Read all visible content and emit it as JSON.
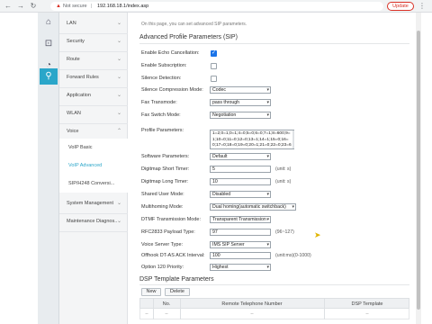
{
  "browser": {
    "security_label": "Not secure",
    "separator": "|",
    "url": "192.168.18.1/index.asp",
    "update_label": "Update",
    "menu_icon": "⋮"
  },
  "sidebar": {
    "items": [
      {
        "label": "LAN",
        "chevron": "⌄"
      },
      {
        "label": "Security",
        "chevron": "⌄"
      },
      {
        "label": "Route",
        "chevron": "⌄"
      },
      {
        "label": "Forward Rules",
        "chevron": "⌄"
      },
      {
        "label": "Application",
        "chevron": "⌄"
      },
      {
        "label": "WLAN",
        "chevron": "⌄"
      },
      {
        "label": "Voice",
        "chevron": "⌃"
      }
    ],
    "subitems": [
      {
        "label": "VoIP Basic"
      },
      {
        "label": "VoIP Advanced"
      },
      {
        "label": "SIP/H248 Conversi..."
      }
    ],
    "bottom_items": [
      {
        "label": "System Management",
        "chevron": "⌄"
      },
      {
        "label": "Maintenance Diagnos...",
        "chevron": "⌄"
      }
    ]
  },
  "main": {
    "intro": "On this page, you can set advanced SIP parameters.",
    "section_title": "Advanced Profile Parameters (SIP)",
    "fields": {
      "echo_cancellation": "Enable Echo Cancellation:",
      "subscription": "Enable Subscription:",
      "silence_detection": "Silence Detection:",
      "silence_compression_mode": "Silence Compression Mode:",
      "silence_compression_value": "Codec",
      "fax_transmode": "Fax Transmode:",
      "fax_transmode_value": "pass through",
      "fax_switch_mode": "Fax Switch Mode:",
      "fax_switch_mode_value": "Negotiation",
      "profile_parameters": "Profile Parameters:",
      "profile_parameters_value": "1=2;0=1;0=1;4=0;5=0;6=0;7=1;8=600;9=1;10=0;11=0;12=0;13=1;14=1;15=0;16=0;17=0;18=0;19=0;20=1;21=0;22=0;23=64;24=60;2",
      "software_parameters": "Software Parameters:",
      "software_parameters_value": "Default",
      "digitmap_short_timer": "Digitmap Short Timer:",
      "digitmap_short_timer_value": "5",
      "digitmap_short_timer_unit": "(unit: s)",
      "digitmap_long_timer": "Digitmap Long Timer:",
      "digitmap_long_timer_value": "10",
      "digitmap_long_timer_unit": "(unit: s)",
      "shared_user_mode": "Shared User Mode:",
      "shared_user_mode_value": "Disabled",
      "multihoming_mode": "Multihoming Mode:",
      "multihoming_mode_value": "Dual homing(automatic switchback)",
      "dtmf_mode": "DTMF Transmission Mode:",
      "dtmf_mode_value": "Transparent Transmission",
      "rfc2833_payload": "RFC2833 Payload Type:",
      "rfc2833_payload_value": "97",
      "rfc2833_payload_range": "(96~127)",
      "voice_server_type": "Voice Server Type:",
      "voice_server_type_value": "IMS SIP Server",
      "offhook_ack": "Offhook DT-AS ACK Interval:",
      "offhook_ack_value": "100",
      "offhook_ack_unit": "(unit:ms)(0-1000)",
      "option120_priority": "Option 120 Priority:",
      "option120_priority_value": "Highest"
    },
    "dsp_title": "DSP Template Parameters",
    "new_button": "New",
    "delete_button": "Delete",
    "table": {
      "columns": [
        "No.",
        "Remote Telephone Number",
        "DSP Template"
      ],
      "row": [
        "--",
        "--",
        "--"
      ]
    }
  },
  "colors": {
    "accent": "#2aa6c9",
    "checkbox": "#1a73e8",
    "warning": "#d93025"
  }
}
